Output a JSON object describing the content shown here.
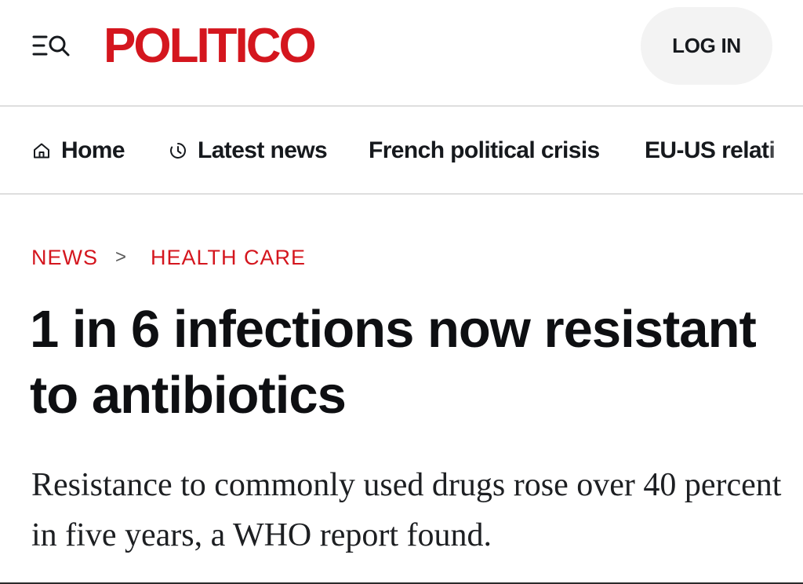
{
  "header": {
    "logo_text": "POLITICO",
    "login_label": "LOG IN",
    "brand_color": "#d4161e",
    "menu_icon": "menu-search-icon"
  },
  "nav": {
    "items": [
      {
        "label": "Home",
        "icon": "home-icon"
      },
      {
        "label": "Latest news",
        "icon": "clock-icon"
      },
      {
        "label": "French political crisis"
      },
      {
        "label": "EU-US relati"
      }
    ]
  },
  "article": {
    "breadcrumb": [
      "NEWS",
      "HEALTH CARE"
    ],
    "breadcrumb_separator": ">",
    "headline": "1 in 6 infections now resistant to antibiotics",
    "dek": "Resistance to commonly used drugs rose over 40 percent in five years, a WHO report found."
  }
}
